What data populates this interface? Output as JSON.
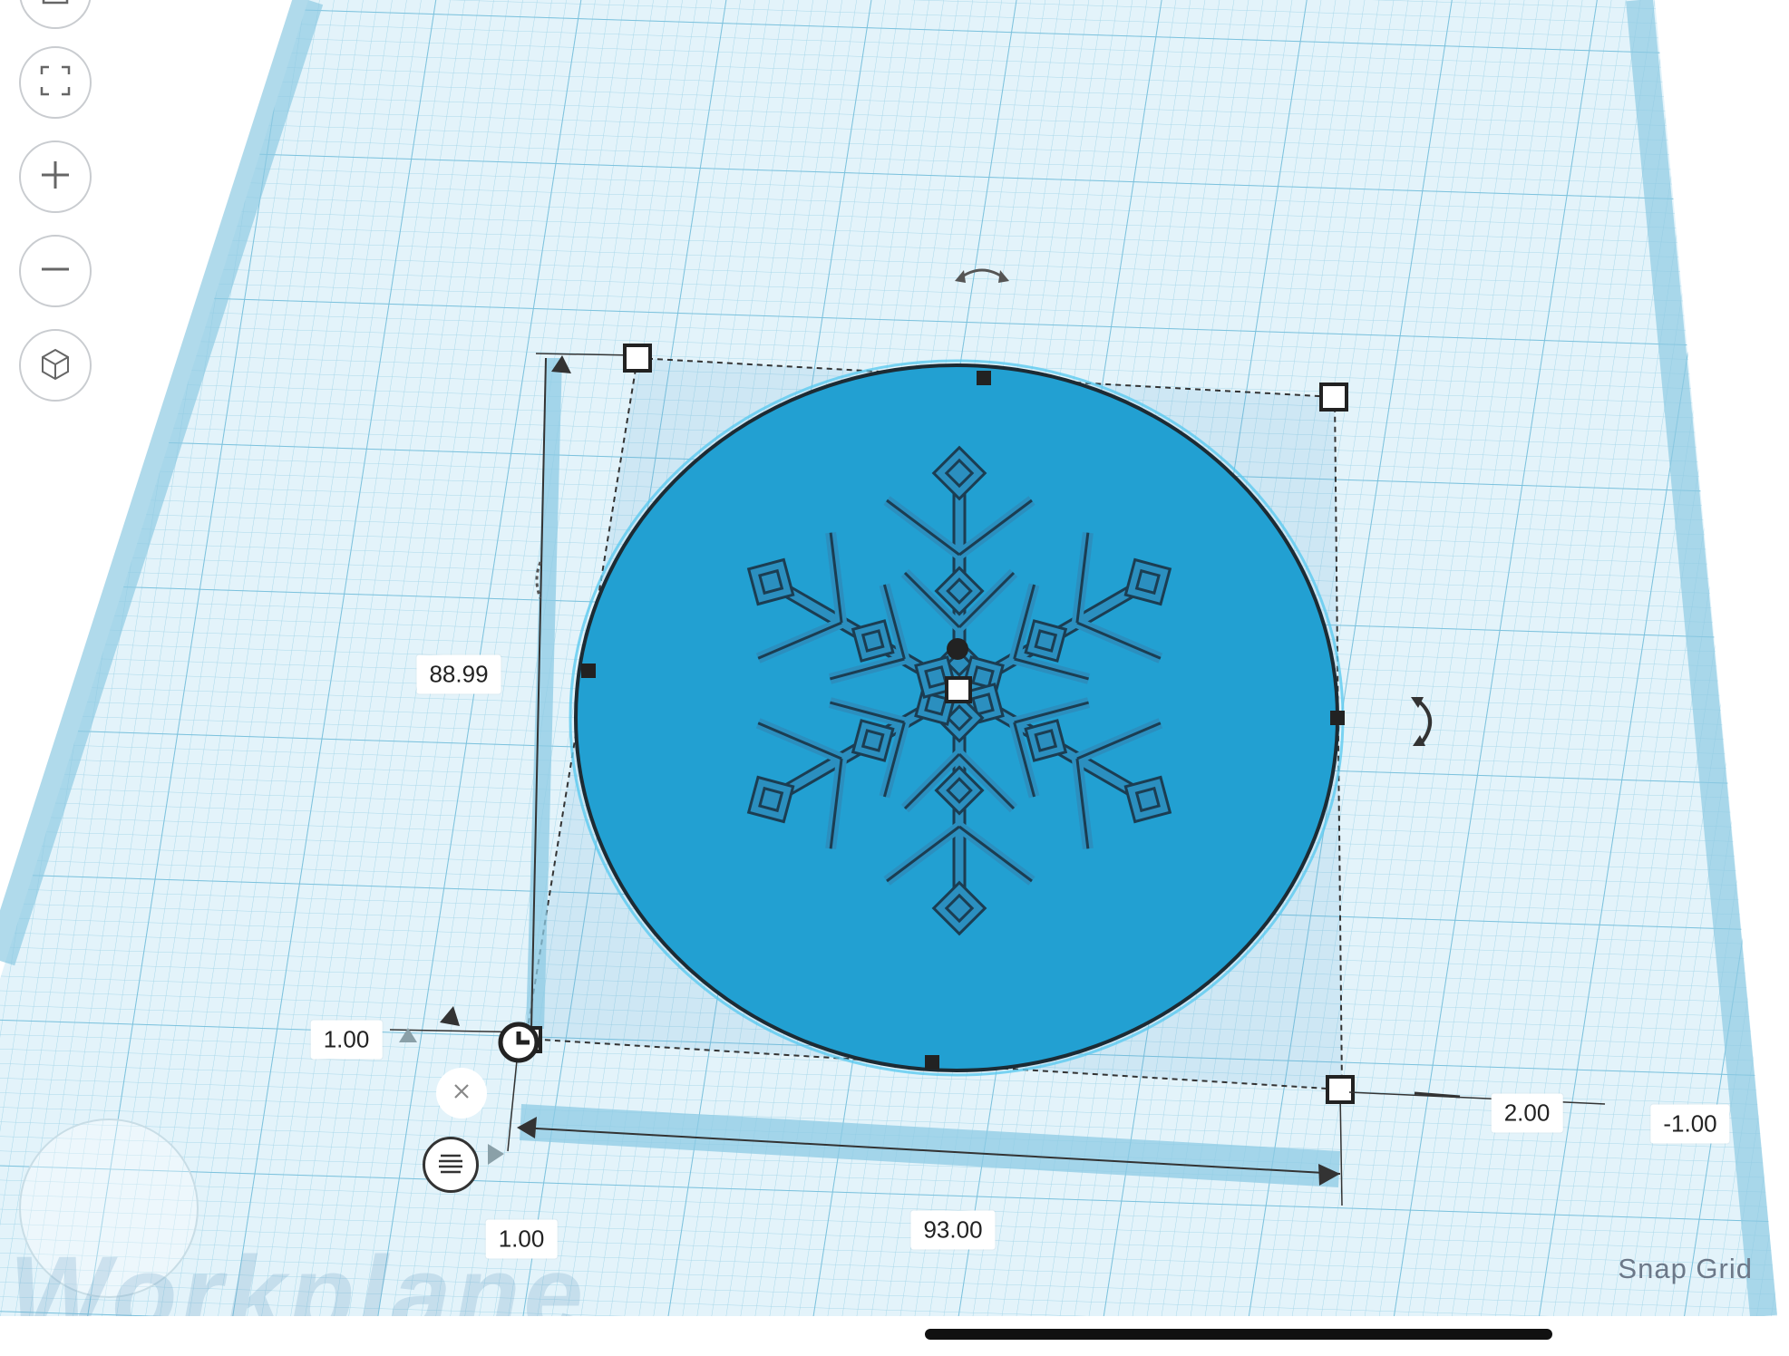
{
  "workplane": {
    "watermark_text": "Workplane",
    "grid_color": "#9fd3e6",
    "shape_color": "#22a0d2"
  },
  "left_toolbar": {
    "items": [
      {
        "name": "home-view",
        "icon": "home-icon"
      },
      {
        "name": "fit-all",
        "icon": "fit-all-icon"
      },
      {
        "name": "zoom-in",
        "icon": "plus-icon"
      },
      {
        "name": "zoom-out",
        "icon": "minus-icon"
      },
      {
        "name": "perspective-toggle",
        "icon": "cube-icon"
      }
    ]
  },
  "dimensions": {
    "length": "88.99",
    "width": "93.00",
    "height": "2.00",
    "elevation": "-1.00",
    "offset_x": "1.00",
    "offset_y": "1.00"
  },
  "tools": {
    "close_icon": "close-icon",
    "menu_icon": "menu-icon",
    "rotate_icon": "rotate-arrow-icon"
  },
  "footer": {
    "snap_grid_label": "Snap Grid"
  }
}
